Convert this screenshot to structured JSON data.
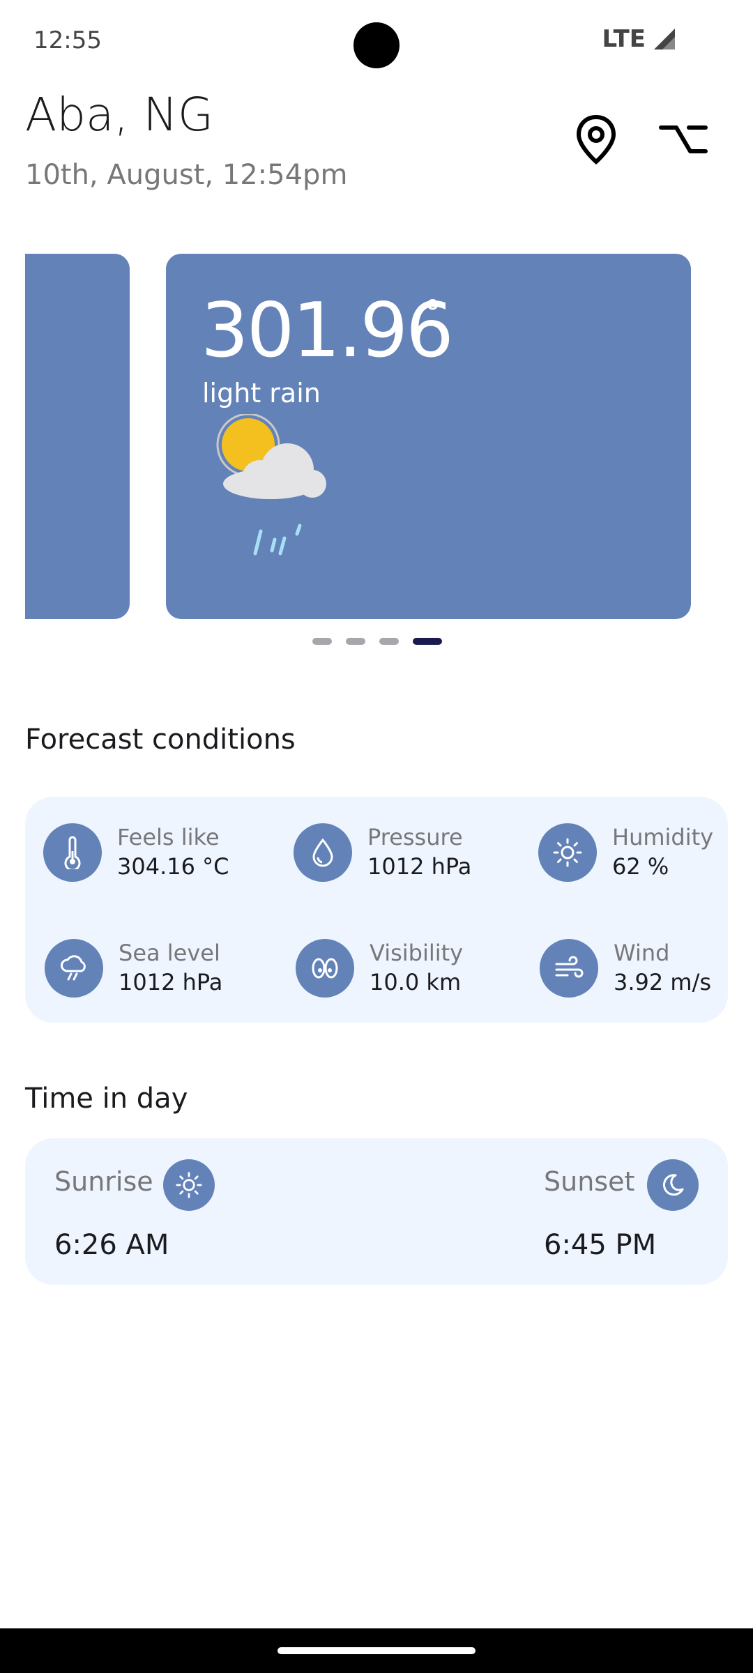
{
  "status_bar": {
    "time": "12:55",
    "network": "LTE"
  },
  "header": {
    "location": "Aba, NG",
    "date": "10th, August, 12:54pm"
  },
  "weather_card": {
    "temperature": "301.96",
    "degree_symbol": "°",
    "description": "light rain",
    "icon": "sun-cloud-rain-icon"
  },
  "carousel": {
    "page_count": 4,
    "active_index": 3
  },
  "forecast": {
    "title": "Forecast conditions",
    "items": [
      {
        "label": "Feels like",
        "value": "304.16 °C",
        "icon": "thermometer-icon"
      },
      {
        "label": "Pressure",
        "value": "1012 hPa",
        "icon": "droplet-icon"
      },
      {
        "label": "Humidity",
        "value": "62 %",
        "icon": "sun-icon"
      },
      {
        "label": "Sea level",
        "value": "1012 hPa",
        "icon": "cloud-drizzle-icon"
      },
      {
        "label": "Visibility",
        "value": "10.0 km",
        "icon": "eyes-icon"
      },
      {
        "label": "Wind",
        "value": "3.92 m/s",
        "icon": "wind-icon"
      }
    ]
  },
  "time_in_day": {
    "title": "Time in day",
    "sunrise": {
      "label": "Sunrise",
      "value": "6:26 AM",
      "icon": "sun-icon"
    },
    "sunset": {
      "label": "Sunset",
      "value": "6:45 PM",
      "icon": "moon-icon"
    }
  },
  "colors": {
    "accent": "#6282b8",
    "panel": "#eef5fe",
    "active_dot": "#1a1a4e"
  }
}
